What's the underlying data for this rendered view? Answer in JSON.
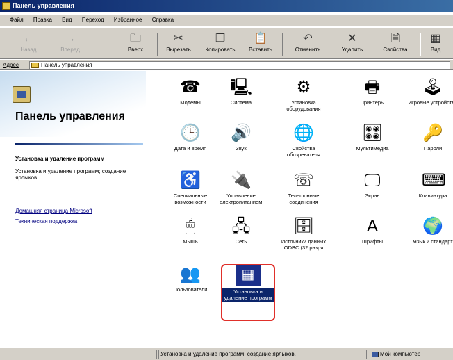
{
  "window": {
    "title": "Панель управления"
  },
  "menu": [
    "Файл",
    "Правка",
    "Вид",
    "Переход",
    "Избранное",
    "Справка"
  ],
  "toolbar": {
    "back": "Назад",
    "forward": "Вперед",
    "up": "Вверх",
    "cut": "Вырезать",
    "copy": "Копировать",
    "paste": "Вставить",
    "undo": "Отменить",
    "delete": "Удалить",
    "properties": "Свойства",
    "view": "Вид"
  },
  "address": {
    "label": "Адрес",
    "value": "Панель управления"
  },
  "left_pane": {
    "title": "Панель управления",
    "selected_title": "Установка и удаление программ",
    "selected_desc": "Установка и удаление программ; создание ярлыков.",
    "links": [
      "Домашняя страница Microsoft",
      "Техническая поддержка"
    ]
  },
  "items": [
    {
      "name": "modem-icon",
      "label": "Модемы",
      "glyph": "☎"
    },
    {
      "name": "system-icon",
      "label": "Система",
      "glyph": "🖳"
    },
    {
      "name": "add-hardware-icon",
      "label": "Установка оборудования",
      "glyph": "⚙"
    },
    {
      "name": "printers-icon",
      "label": "Принтеры",
      "glyph": "🖶"
    },
    {
      "name": "game-controllers-icon",
      "label": "Игровые устройства",
      "glyph": "🕹"
    },
    {
      "name": "date-time-icon",
      "label": "Дата и время",
      "glyph": "🕒"
    },
    {
      "name": "sound-icon",
      "label": "Звук",
      "glyph": "🔊"
    },
    {
      "name": "internet-options-icon",
      "label": "Свойства обозревателя",
      "glyph": "🌐"
    },
    {
      "name": "multimedia-icon",
      "label": "Мультимедиа",
      "glyph": "🎛"
    },
    {
      "name": "passwords-icon",
      "label": "Пароли",
      "glyph": "🔑"
    },
    {
      "name": "accessibility-icon",
      "label": "Специальные возможности",
      "glyph": "♿"
    },
    {
      "name": "power-management-icon",
      "label": "Управление электропитанием",
      "glyph": "🔌"
    },
    {
      "name": "telephony-icon",
      "label": "Телефонные соединения",
      "glyph": "☏"
    },
    {
      "name": "display-icon",
      "label": "Экран",
      "glyph": "🖵"
    },
    {
      "name": "keyboard-icon",
      "label": "Клавиатура",
      "glyph": "⌨"
    },
    {
      "name": "mouse-icon",
      "label": "Мышь",
      "glyph": "🖱"
    },
    {
      "name": "network-icon",
      "label": "Сеть",
      "glyph": "🖧"
    },
    {
      "name": "odbc-icon",
      "label": "Источники данных ODBC (32 разря",
      "glyph": "🗄"
    },
    {
      "name": "fonts-icon",
      "label": "Шрифты",
      "glyph": "A"
    },
    {
      "name": "regional-settings-icon",
      "label": "Язык и стандарт",
      "glyph": "🌍"
    },
    {
      "name": "users-icon",
      "label": "Пользователи",
      "glyph": "👥"
    },
    {
      "name": "add-remove-programs-icon",
      "label": "Установка и удаление программ",
      "glyph": "▦"
    }
  ],
  "status": {
    "text": "Установка и удаление программ; создание ярлыков.",
    "zone": "Мой компьютер"
  }
}
